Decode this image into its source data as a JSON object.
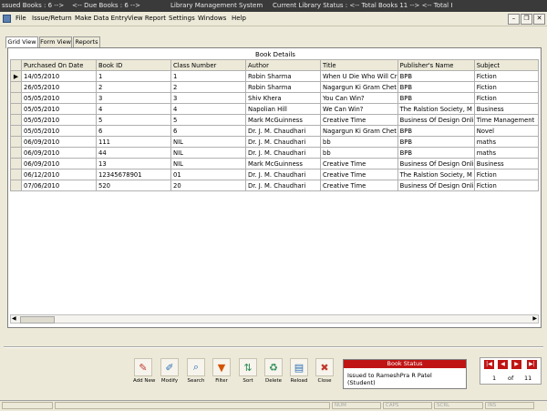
{
  "titlebar": {
    "issued": "ssued Books : 6 -->",
    "due": "<-- Due Books : 6 -->",
    "app_title": "Library Management System",
    "library_status": "Current Library Status : <-- Total Books 11 --> <-- Total I"
  },
  "menu": [
    "File",
    "Issue/Return",
    "Make Data Entry",
    "View Report",
    "Settings",
    "Windows",
    "Help"
  ],
  "tabs": [
    "Grid View",
    "Form View",
    "Reports"
  ],
  "grid": {
    "caption": "Book Details",
    "columns": [
      "Purchased On Date",
      "Book ID",
      "Class Number",
      "Author",
      "Title",
      "Publisher's Name",
      "Subject"
    ],
    "rows": [
      [
        "14/05/2010",
        "1",
        "1",
        "Robin Sharma",
        "When U Die Who Will Cr",
        "BPB",
        "Fiction"
      ],
      [
        "26/05/2010",
        "2",
        "2",
        "Robin Sharma",
        "Nagargun Ki Gram Chet",
        "BPB",
        "Fiction"
      ],
      [
        "05/05/2010",
        "3",
        "3",
        "Shiv Khera",
        "You Can Win?",
        "BPB",
        "Fiction"
      ],
      [
        "05/05/2010",
        "4",
        "4",
        "Napolian Hill",
        "We Can Win?",
        "The Ralstion Society, M",
        "Business"
      ],
      [
        "05/05/2010",
        "5",
        "5",
        "Mark McGuinness",
        "Creative Time",
        "Business Of Design Onli",
        "Time Management"
      ],
      [
        "05/05/2010",
        "6",
        "6",
        "Dr. J. M. Chaudhari",
        "Nagargun Ki Gram Chet",
        "BPB",
        "Novel"
      ],
      [
        "06/09/2010",
        "111",
        "NIL",
        "Dr. J. M. Chaudhari",
        "bb",
        "BPB",
        "maths"
      ],
      [
        "06/09/2010",
        "44",
        "NIL",
        "Dr. J. M. Chaudhari",
        "bb",
        "BPB",
        "maths"
      ],
      [
        "06/09/2010",
        "13",
        "NIL",
        "Mark McGuinness",
        "Creative Time",
        "Business Of Design Onli",
        "Business"
      ],
      [
        "06/12/2010",
        "12345678901",
        "01",
        "Dr. J. M. Chaudhari",
        "Creative Time",
        "The Ralstion Society, M",
        "Fiction"
      ],
      [
        "07/06/2010",
        "520",
        "20",
        "Dr. J. M. Chaudhari",
        "Creative Time",
        "Business Of Design Onli",
        "Fiction"
      ]
    ],
    "current_row_marker": "▶"
  },
  "toolbar": {
    "buttons": [
      {
        "label": "Add New",
        "icon": "add-new-icon",
        "glyph": "✎",
        "color": "#c0392b"
      },
      {
        "label": "Modify",
        "icon": "modify-icon",
        "glyph": "✐",
        "color": "#2e6fb5"
      },
      {
        "label": "Search",
        "icon": "search-icon",
        "glyph": "⌕",
        "color": "#2e6fb5"
      },
      {
        "label": "Filter",
        "icon": "filter-icon",
        "glyph": "▼",
        "color": "#d35400"
      },
      {
        "label": "Sort",
        "icon": "sort-icon",
        "glyph": "⇅",
        "color": "#2e8b57"
      },
      {
        "label": "Delete",
        "icon": "delete-icon",
        "glyph": "♻",
        "color": "#2e8b57"
      },
      {
        "label": "Reload",
        "icon": "reload-icon",
        "glyph": "▤",
        "color": "#2e6fb5"
      },
      {
        "label": "Close",
        "icon": "close-icon",
        "glyph": "✖",
        "color": "#c0392b"
      }
    ]
  },
  "book_status": {
    "header": "Book Status",
    "line1": "Issued to RameshPra R Patel",
    "line2": "(Student)"
  },
  "navigator": {
    "first": "|◀",
    "prev": "◀",
    "next": "▶",
    "last": "▶|",
    "current": "1",
    "of_label": "of",
    "total": "11"
  },
  "statusbar": [
    "NUM",
    "CAPS",
    "SCRL",
    "INS"
  ],
  "colors": {
    "accent_red": "#c01414",
    "background": "#ece9d8"
  }
}
